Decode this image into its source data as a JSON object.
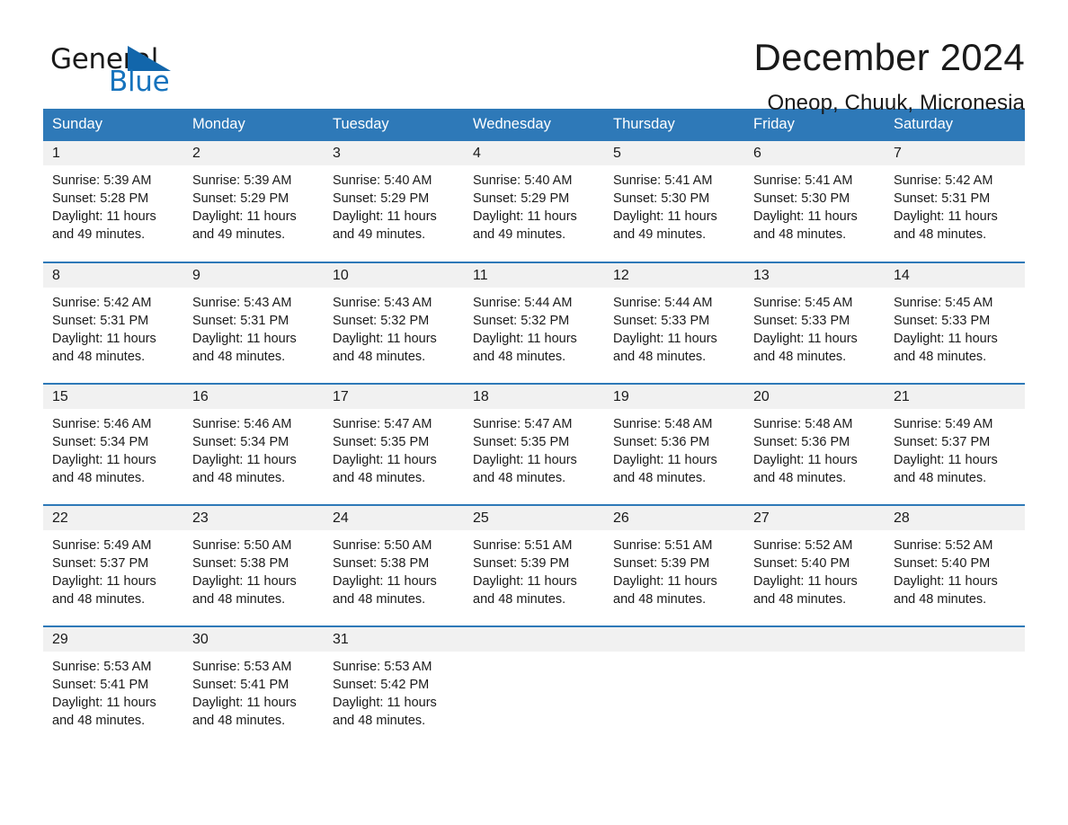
{
  "logo": {
    "word_one": "General",
    "word_two": "Blue",
    "triangle_icon": "triangle-icon",
    "brand_blue": "#1266ab",
    "text_black": "#1a1a1a"
  },
  "header": {
    "title": "December 2024",
    "subtitle": "Oneop, Chuuk, Micronesia"
  },
  "calendar": {
    "header_bg": "#2e79b8",
    "daynum_bg": "#f1f1f1",
    "weekday_headers": [
      "Sunday",
      "Monday",
      "Tuesday",
      "Wednesday",
      "Thursday",
      "Friday",
      "Saturday"
    ],
    "weeks": [
      [
        {
          "day": "1",
          "sunrise": "Sunrise: 5:39 AM",
          "sunset": "Sunset: 5:28 PM",
          "daylight_line1": "Daylight: 11 hours",
          "daylight_line2": "and 49 minutes."
        },
        {
          "day": "2",
          "sunrise": "Sunrise: 5:39 AM",
          "sunset": "Sunset: 5:29 PM",
          "daylight_line1": "Daylight: 11 hours",
          "daylight_line2": "and 49 minutes."
        },
        {
          "day": "3",
          "sunrise": "Sunrise: 5:40 AM",
          "sunset": "Sunset: 5:29 PM",
          "daylight_line1": "Daylight: 11 hours",
          "daylight_line2": "and 49 minutes."
        },
        {
          "day": "4",
          "sunrise": "Sunrise: 5:40 AM",
          "sunset": "Sunset: 5:29 PM",
          "daylight_line1": "Daylight: 11 hours",
          "daylight_line2": "and 49 minutes."
        },
        {
          "day": "5",
          "sunrise": "Sunrise: 5:41 AM",
          "sunset": "Sunset: 5:30 PM",
          "daylight_line1": "Daylight: 11 hours",
          "daylight_line2": "and 49 minutes."
        },
        {
          "day": "6",
          "sunrise": "Sunrise: 5:41 AM",
          "sunset": "Sunset: 5:30 PM",
          "daylight_line1": "Daylight: 11 hours",
          "daylight_line2": "and 48 minutes."
        },
        {
          "day": "7",
          "sunrise": "Sunrise: 5:42 AM",
          "sunset": "Sunset: 5:31 PM",
          "daylight_line1": "Daylight: 11 hours",
          "daylight_line2": "and 48 minutes."
        }
      ],
      [
        {
          "day": "8",
          "sunrise": "Sunrise: 5:42 AM",
          "sunset": "Sunset: 5:31 PM",
          "daylight_line1": "Daylight: 11 hours",
          "daylight_line2": "and 48 minutes."
        },
        {
          "day": "9",
          "sunrise": "Sunrise: 5:43 AM",
          "sunset": "Sunset: 5:31 PM",
          "daylight_line1": "Daylight: 11 hours",
          "daylight_line2": "and 48 minutes."
        },
        {
          "day": "10",
          "sunrise": "Sunrise: 5:43 AM",
          "sunset": "Sunset: 5:32 PM",
          "daylight_line1": "Daylight: 11 hours",
          "daylight_line2": "and 48 minutes."
        },
        {
          "day": "11",
          "sunrise": "Sunrise: 5:44 AM",
          "sunset": "Sunset: 5:32 PM",
          "daylight_line1": "Daylight: 11 hours",
          "daylight_line2": "and 48 minutes."
        },
        {
          "day": "12",
          "sunrise": "Sunrise: 5:44 AM",
          "sunset": "Sunset: 5:33 PM",
          "daylight_line1": "Daylight: 11 hours",
          "daylight_line2": "and 48 minutes."
        },
        {
          "day": "13",
          "sunrise": "Sunrise: 5:45 AM",
          "sunset": "Sunset: 5:33 PM",
          "daylight_line1": "Daylight: 11 hours",
          "daylight_line2": "and 48 minutes."
        },
        {
          "day": "14",
          "sunrise": "Sunrise: 5:45 AM",
          "sunset": "Sunset: 5:33 PM",
          "daylight_line1": "Daylight: 11 hours",
          "daylight_line2": "and 48 minutes."
        }
      ],
      [
        {
          "day": "15",
          "sunrise": "Sunrise: 5:46 AM",
          "sunset": "Sunset: 5:34 PM",
          "daylight_line1": "Daylight: 11 hours",
          "daylight_line2": "and 48 minutes."
        },
        {
          "day": "16",
          "sunrise": "Sunrise: 5:46 AM",
          "sunset": "Sunset: 5:34 PM",
          "daylight_line1": "Daylight: 11 hours",
          "daylight_line2": "and 48 minutes."
        },
        {
          "day": "17",
          "sunrise": "Sunrise: 5:47 AM",
          "sunset": "Sunset: 5:35 PM",
          "daylight_line1": "Daylight: 11 hours",
          "daylight_line2": "and 48 minutes."
        },
        {
          "day": "18",
          "sunrise": "Sunrise: 5:47 AM",
          "sunset": "Sunset: 5:35 PM",
          "daylight_line1": "Daylight: 11 hours",
          "daylight_line2": "and 48 minutes."
        },
        {
          "day": "19",
          "sunrise": "Sunrise: 5:48 AM",
          "sunset": "Sunset: 5:36 PM",
          "daylight_line1": "Daylight: 11 hours",
          "daylight_line2": "and 48 minutes."
        },
        {
          "day": "20",
          "sunrise": "Sunrise: 5:48 AM",
          "sunset": "Sunset: 5:36 PM",
          "daylight_line1": "Daylight: 11 hours",
          "daylight_line2": "and 48 minutes."
        },
        {
          "day": "21",
          "sunrise": "Sunrise: 5:49 AM",
          "sunset": "Sunset: 5:37 PM",
          "daylight_line1": "Daylight: 11 hours",
          "daylight_line2": "and 48 minutes."
        }
      ],
      [
        {
          "day": "22",
          "sunrise": "Sunrise: 5:49 AM",
          "sunset": "Sunset: 5:37 PM",
          "daylight_line1": "Daylight: 11 hours",
          "daylight_line2": "and 48 minutes."
        },
        {
          "day": "23",
          "sunrise": "Sunrise: 5:50 AM",
          "sunset": "Sunset: 5:38 PM",
          "daylight_line1": "Daylight: 11 hours",
          "daylight_line2": "and 48 minutes."
        },
        {
          "day": "24",
          "sunrise": "Sunrise: 5:50 AM",
          "sunset": "Sunset: 5:38 PM",
          "daylight_line1": "Daylight: 11 hours",
          "daylight_line2": "and 48 minutes."
        },
        {
          "day": "25",
          "sunrise": "Sunrise: 5:51 AM",
          "sunset": "Sunset: 5:39 PM",
          "daylight_line1": "Daylight: 11 hours",
          "daylight_line2": "and 48 minutes."
        },
        {
          "day": "26",
          "sunrise": "Sunrise: 5:51 AM",
          "sunset": "Sunset: 5:39 PM",
          "daylight_line1": "Daylight: 11 hours",
          "daylight_line2": "and 48 minutes."
        },
        {
          "day": "27",
          "sunrise": "Sunrise: 5:52 AM",
          "sunset": "Sunset: 5:40 PM",
          "daylight_line1": "Daylight: 11 hours",
          "daylight_line2": "and 48 minutes."
        },
        {
          "day": "28",
          "sunrise": "Sunrise: 5:52 AM",
          "sunset": "Sunset: 5:40 PM",
          "daylight_line1": "Daylight: 11 hours",
          "daylight_line2": "and 48 minutes."
        }
      ],
      [
        {
          "day": "29",
          "sunrise": "Sunrise: 5:53 AM",
          "sunset": "Sunset: 5:41 PM",
          "daylight_line1": "Daylight: 11 hours",
          "daylight_line2": "and 48 minutes."
        },
        {
          "day": "30",
          "sunrise": "Sunrise: 5:53 AM",
          "sunset": "Sunset: 5:41 PM",
          "daylight_line1": "Daylight: 11 hours",
          "daylight_line2": "and 48 minutes."
        },
        {
          "day": "31",
          "sunrise": "Sunrise: 5:53 AM",
          "sunset": "Sunset: 5:42 PM",
          "daylight_line1": "Daylight: 11 hours",
          "daylight_line2": "and 48 minutes."
        },
        {
          "day": "",
          "sunrise": "",
          "sunset": "",
          "daylight_line1": "",
          "daylight_line2": ""
        },
        {
          "day": "",
          "sunrise": "",
          "sunset": "",
          "daylight_line1": "",
          "daylight_line2": ""
        },
        {
          "day": "",
          "sunrise": "",
          "sunset": "",
          "daylight_line1": "",
          "daylight_line2": ""
        },
        {
          "day": "",
          "sunrise": "",
          "sunset": "",
          "daylight_line1": "",
          "daylight_line2": ""
        }
      ]
    ]
  }
}
